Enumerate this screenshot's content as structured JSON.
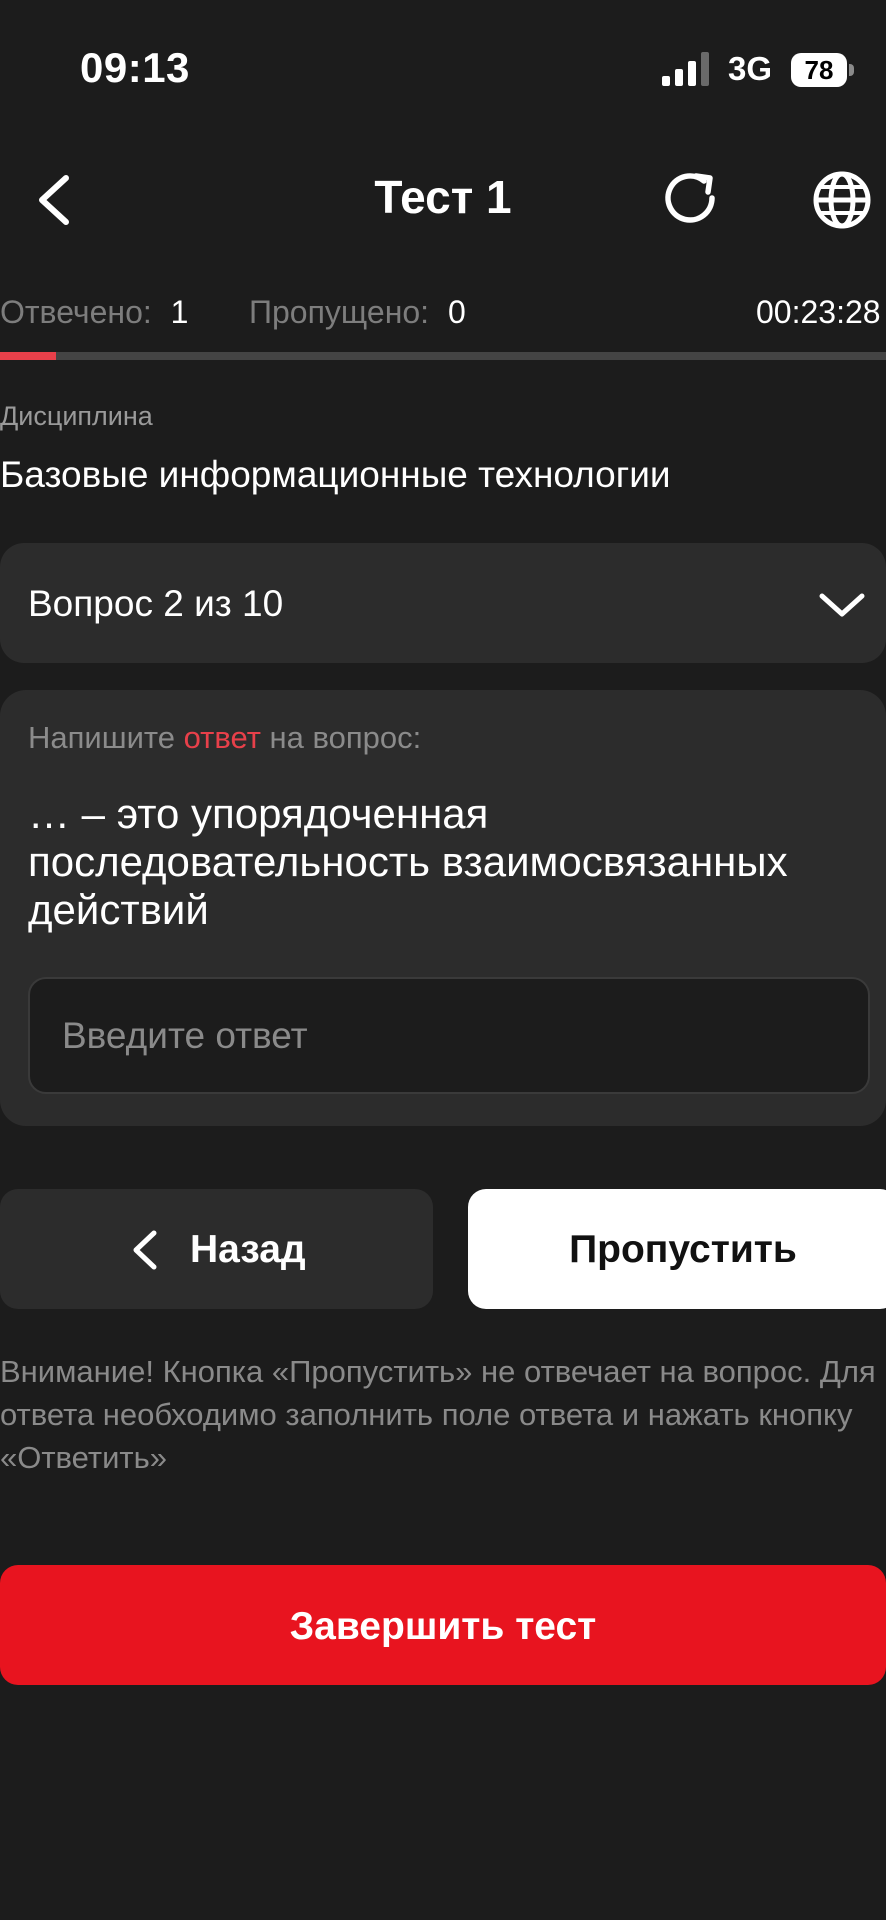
{
  "status_bar": {
    "time": "09:13",
    "network": "3G",
    "battery": "78"
  },
  "header": {
    "title": "Тест 1"
  },
  "stats": {
    "answered_label": "Отвечено:",
    "answered_value": "1",
    "skipped_label": "Пропущено:",
    "skipped_value": "0",
    "timer": "00:23:28",
    "progress_fraction": 0.063
  },
  "discipline": {
    "label": "Дисциплина",
    "value": "Базовые информационные технологии"
  },
  "question_selector": {
    "label": "Вопрос 2 из 10"
  },
  "question": {
    "prompt_before": "Напишите ",
    "prompt_highlight": "ответ",
    "prompt_after": " на вопрос:",
    "text": "… – это упорядоченная последовательность взаимосвязанных действий",
    "answer_placeholder": "Введите ответ",
    "answer_value": ""
  },
  "buttons": {
    "back_label": "Назад",
    "skip_label": "Пропустить",
    "finish_label": "Завершить тест"
  },
  "notice": "Внимание! Кнопка «Пропустить» не отвечает на вопрос. Для ответа необходимо заполнить поле ответа и нажать кнопку «Ответить»",
  "colors": {
    "background": "#1c1c1c",
    "card": "#2c2c2c",
    "accent_red": "#e8141f",
    "highlight_red": "#e8404a"
  },
  "icons": {
    "back": "chevron-left-icon",
    "refresh": "refresh-icon",
    "language": "globe-icon",
    "dropdown": "chevron-down-icon"
  }
}
